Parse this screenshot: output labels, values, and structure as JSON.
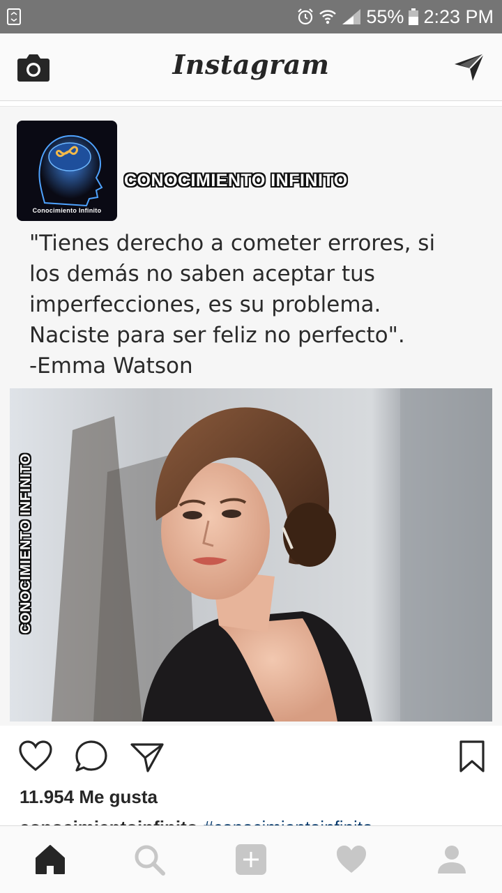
{
  "status_bar": {
    "battery": "55%",
    "time": "2:23 PM"
  },
  "header": {
    "title": "Instagram"
  },
  "post": {
    "brand_name": "Conocimiento Infinito",
    "brand_logo_text": "Conocimiento Infinito",
    "quote_lines": [
      "\"Tienes derecho a cometer errores, si",
      "los demás no saben aceptar tus",
      "imperfecciones, es su problema.",
      "Naciste para ser feliz no perfecto\".",
      "-Emma Watson"
    ],
    "watermark": "Conocimiento Infinito",
    "likes": "11.954 Me gusta",
    "caption_user": "conocimientoinfinito",
    "caption_tag": "#conocimientoinfinito"
  },
  "colors": {
    "status_bar": "#757575",
    "bar_background": "#fafafa",
    "icon": "#262626",
    "inactive_icon": "#c7c7c7",
    "hashtag": "#003569"
  },
  "icons": {
    "camera": "camera-icon",
    "direct": "direct-message-icon",
    "like": "heart-outline-icon",
    "comment": "comment-icon",
    "share": "share-icon",
    "save": "bookmark-icon",
    "home": "home-icon",
    "search": "search-icon",
    "add": "add-post-icon",
    "activity": "heart-filled-icon",
    "profile": "profile-icon"
  }
}
